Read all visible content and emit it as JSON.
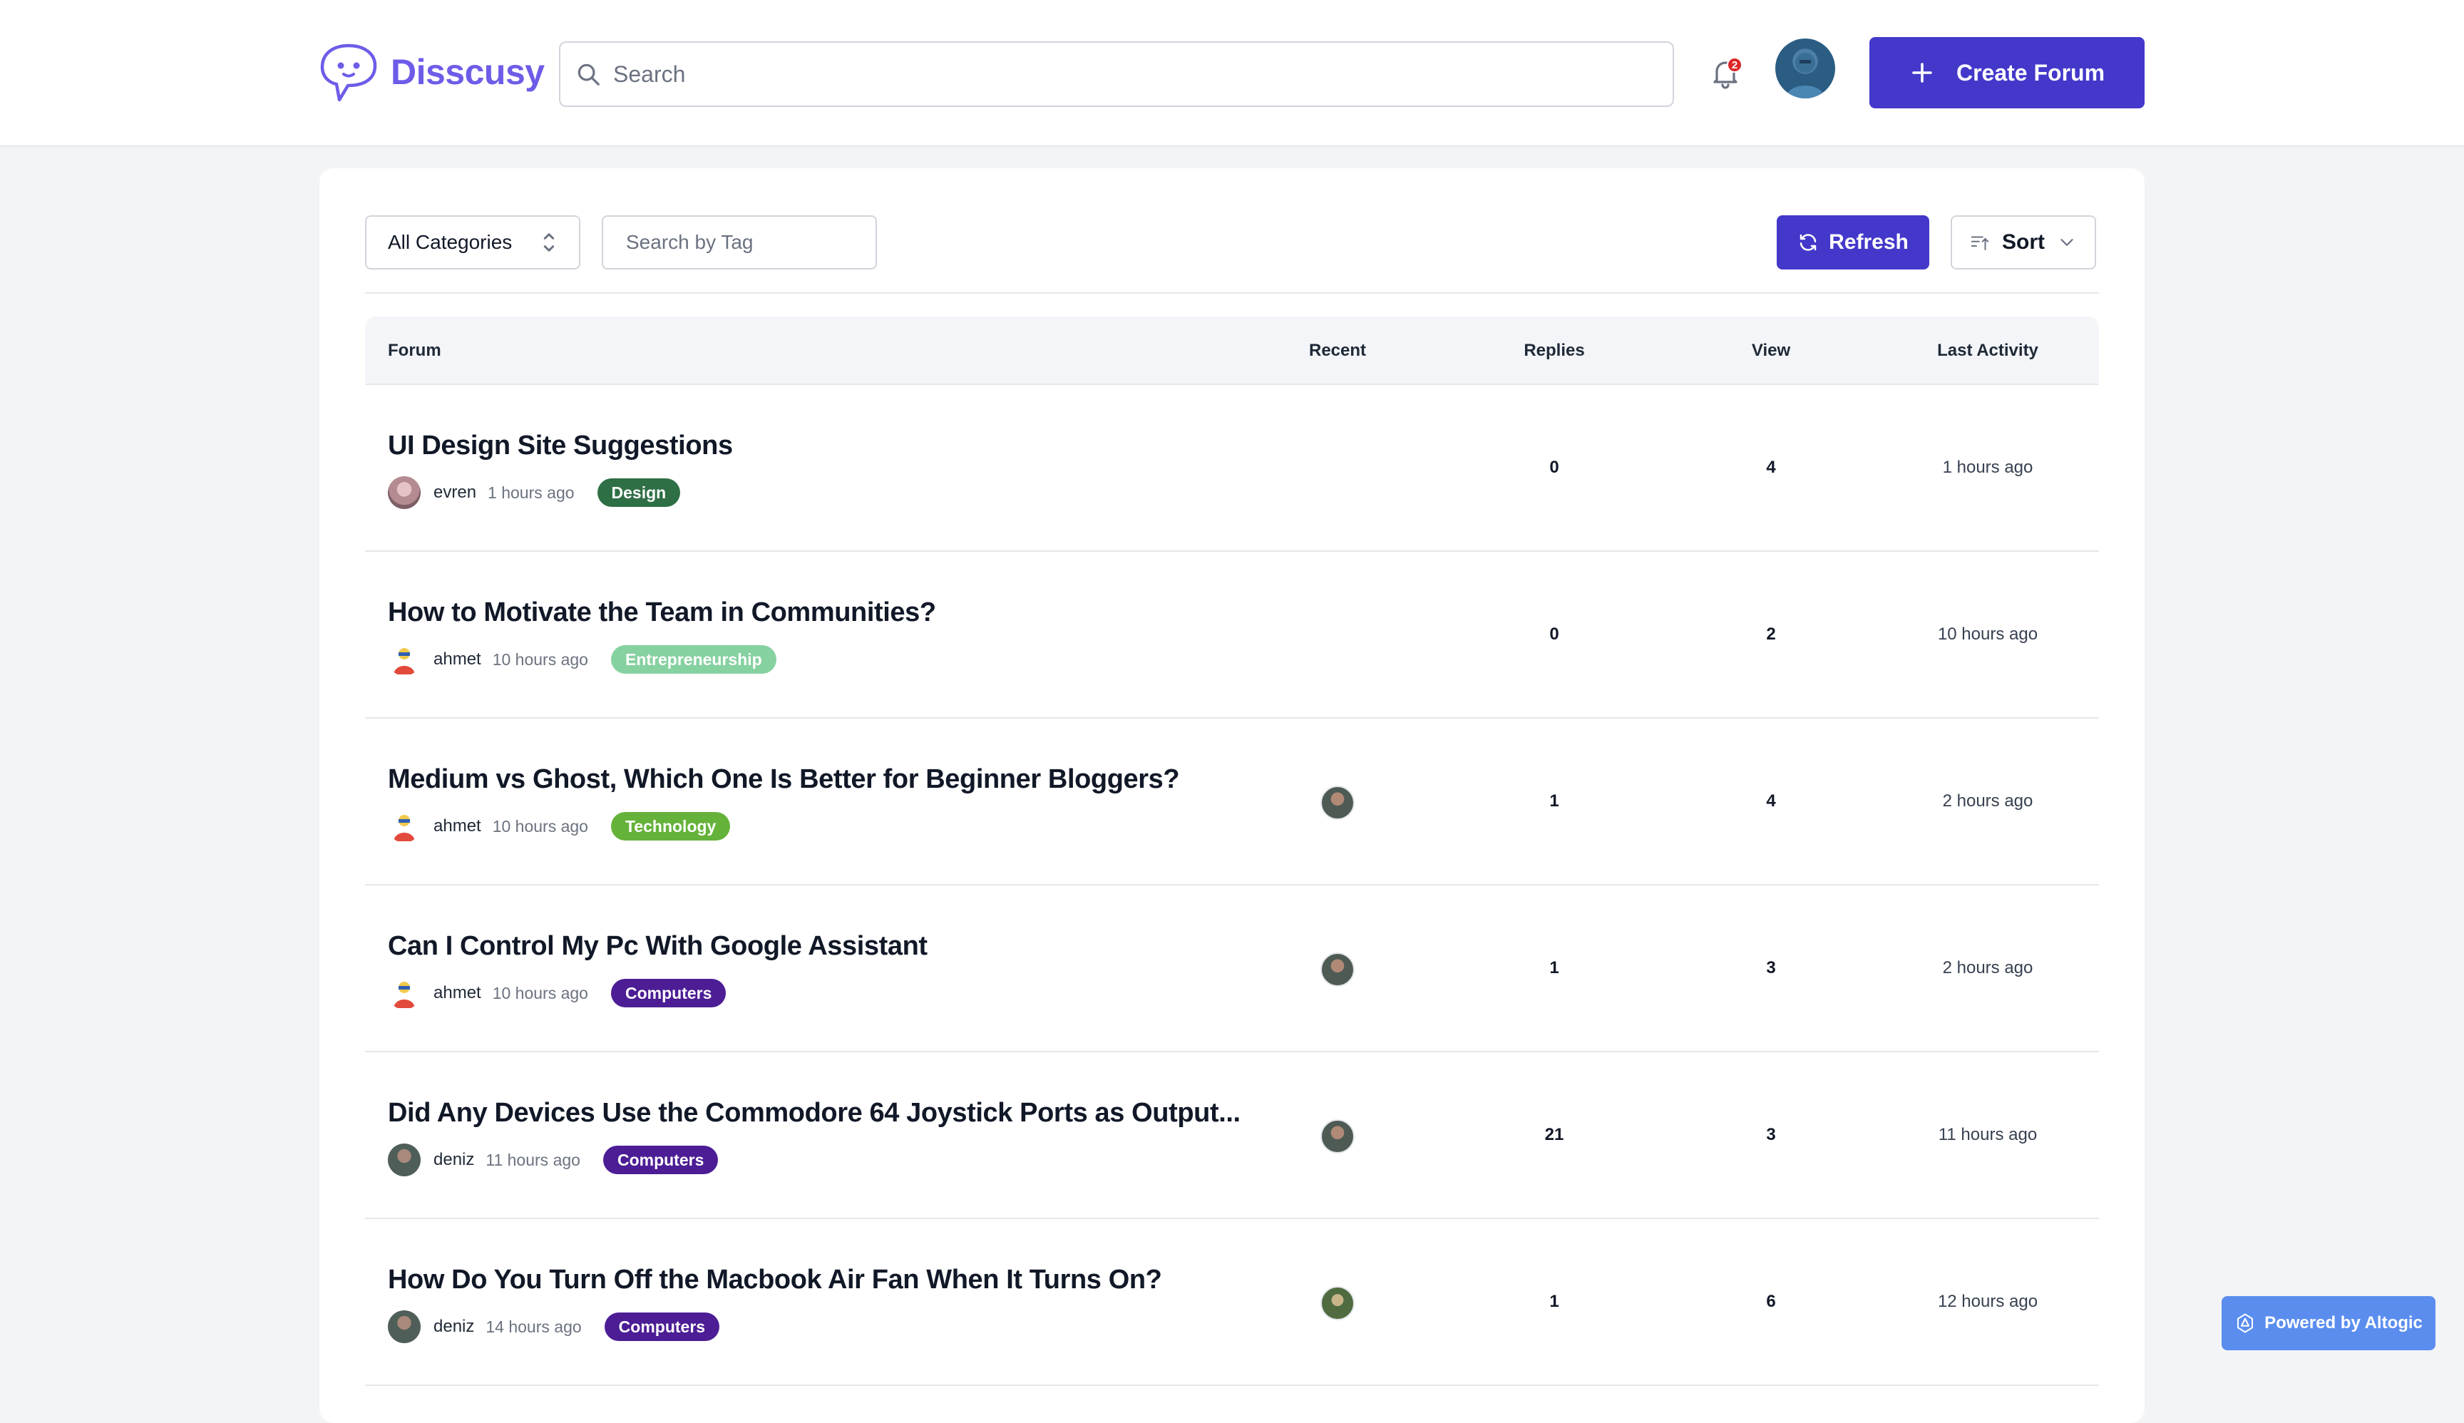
{
  "header": {
    "logo_text": "Disscusy",
    "search_placeholder": "Search",
    "notification_count": "2",
    "create_label": "Create Forum"
  },
  "filters": {
    "category_value": "All Categories",
    "tag_placeholder": "Search by Tag",
    "refresh_label": "Refresh",
    "sort_label": "Sort"
  },
  "table": {
    "columns": {
      "forum": "Forum",
      "recent": "Recent",
      "replies": "Replies",
      "view": "View",
      "last": "Last Activity"
    },
    "rows": [
      {
        "title": "UI Design Site Suggestions",
        "user": "evren",
        "time": "1 hours ago",
        "tag": "Design",
        "tag_color": "#2f6f45",
        "replies": "0",
        "views": "4",
        "last": "1 hours ago"
      },
      {
        "title": "How to Motivate the Team in Communities?",
        "user": "ahmet",
        "time": "10 hours ago",
        "tag": "Entrepreneurship",
        "tag_color": "#86d1a0",
        "replies": "0",
        "views": "2",
        "last": "10 hours ago"
      },
      {
        "title": "Medium vs Ghost, Which One Is Better for Beginner Bloggers?",
        "user": "ahmet",
        "time": "10 hours ago",
        "tag": "Technology",
        "tag_color": "#65b23a",
        "replies": "1",
        "views": "4",
        "last": "2 hours ago"
      },
      {
        "title": "Can I Control My Pc With Google Assistant",
        "user": "ahmet",
        "time": "10 hours ago",
        "tag": "Computers",
        "tag_color": "#4c1d95",
        "replies": "1",
        "views": "3",
        "last": "2 hours ago"
      },
      {
        "title": "Did Any Devices Use the Commodore 64 Joystick Ports as Output...",
        "user": "deniz",
        "time": "11 hours ago",
        "tag": "Computers",
        "tag_color": "#4c1d95",
        "replies": "21",
        "views": "3",
        "last": "11 hours ago"
      },
      {
        "title": "How Do You Turn Off the Macbook Air Fan When It Turns On?",
        "user": "deniz",
        "time": "14 hours ago",
        "tag": "Computers",
        "tag_color": "#4c1d95",
        "replies": "1",
        "views": "6",
        "last": "12 hours ago"
      }
    ]
  },
  "powered_label": "Powered by Altogic",
  "colors": {
    "primary": "#4338ca",
    "logo": "#6d5ce8",
    "badge": "#dc2626"
  }
}
